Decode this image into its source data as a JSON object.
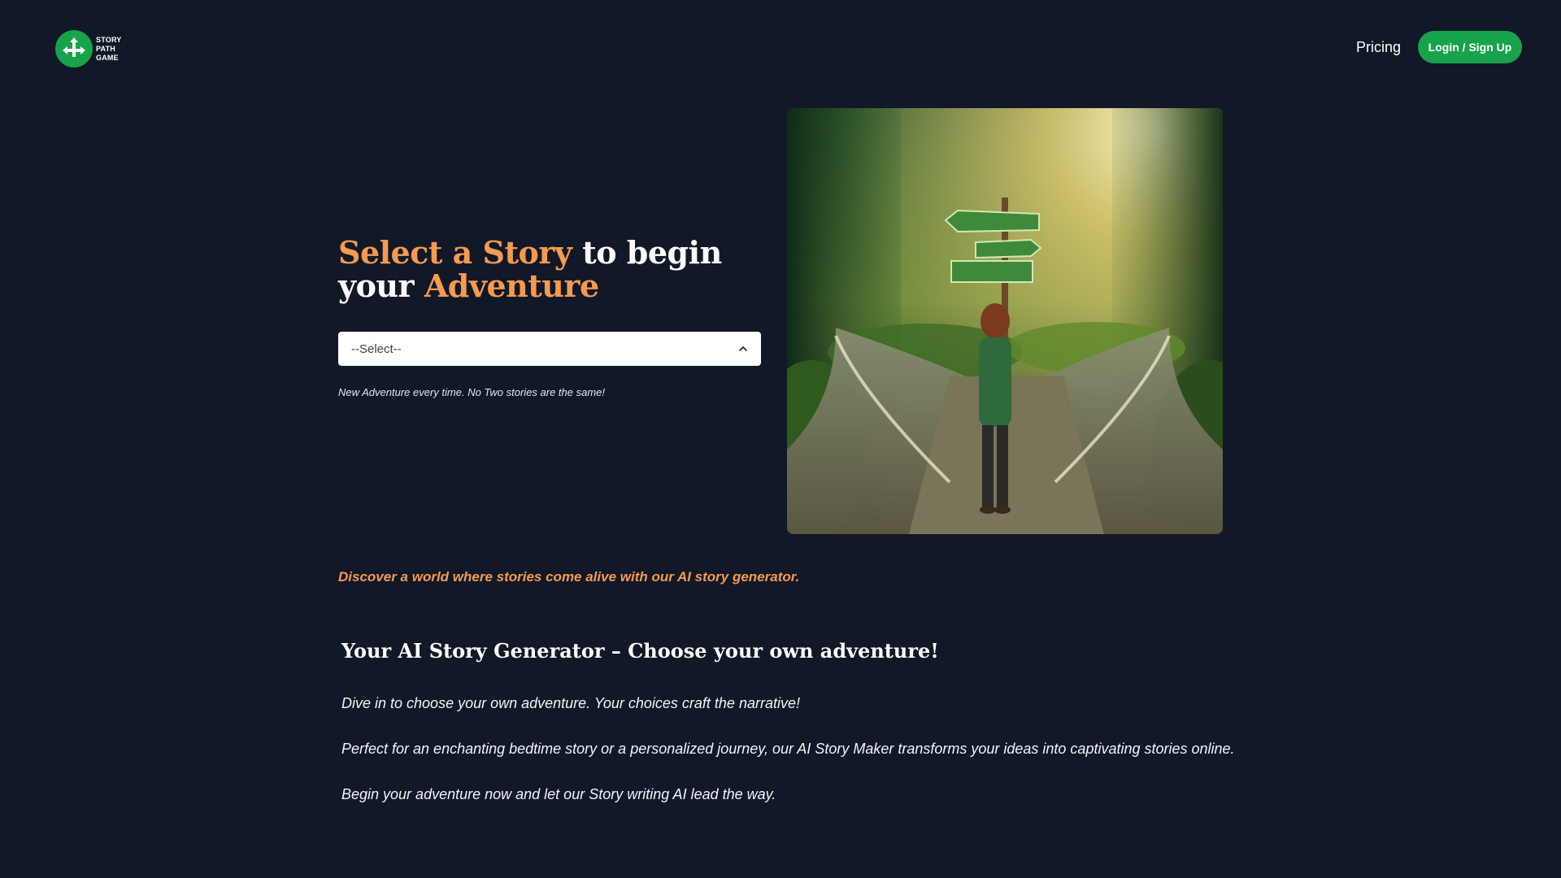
{
  "header": {
    "logo_lines": [
      "STORY",
      "PATH",
      "GAME"
    ],
    "nav_pricing": "Pricing",
    "login_label": "Login / Sign Up"
  },
  "hero": {
    "title_accent_1": "Select a Story",
    "title_plain": " to begin your ",
    "title_accent_2": "Adventure",
    "select_value": "--Select--",
    "tagline": "New Adventure every time. No Two stories are the same!"
  },
  "discover_text": "Discover a world where stories come alive with our AI story generator.",
  "content": {
    "heading": "Your AI Story Generator – Choose your own adventure!",
    "paragraphs": [
      "Dive in to choose your own adventure. Your choices craft the narrative!",
      "Perfect for an enchanting bedtime story or a personalized journey, our AI Story Maker transforms your ideas into captivating stories online.",
      "Begin your adventure now and let our Story writing AI lead the way."
    ]
  },
  "colors": {
    "background": "#111827",
    "brand_green": "#16a34a",
    "accent_orange": "#f59a4f"
  },
  "icons": {
    "logo": "crossroads-arrows-icon",
    "select": "chevron-up-icon"
  }
}
